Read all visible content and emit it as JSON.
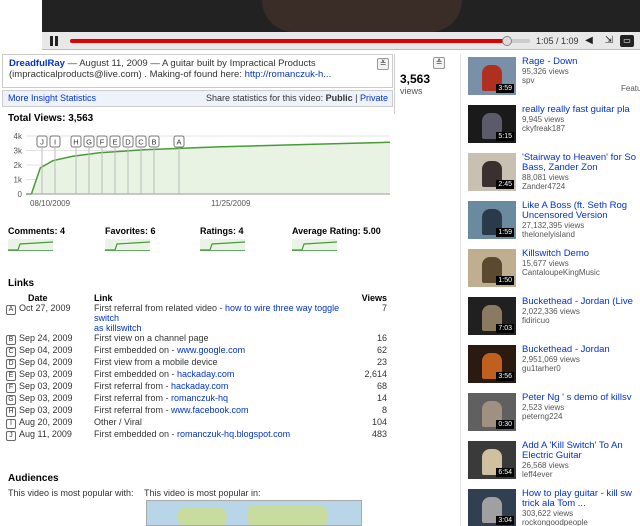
{
  "player": {
    "time": "1:05 / 1:09",
    "progress": 0.95
  },
  "description": {
    "author": "DreadfulRay",
    "line1_rest": " — August 11, 2009 — A guitar built by Impractical Products",
    "line2_text": "(impracticalproducts@live.com) . Making-of found here: ",
    "line2_link": "http://romanczuk-h..."
  },
  "views_summary": {
    "count": "3,563",
    "label": "views"
  },
  "insight": {
    "more_link": "More Insight Statistics",
    "share_prefix": "Share statistics for this video:",
    "public": "Public",
    "private": "Private"
  },
  "total_views": {
    "title": "Total Views: 3,563",
    "yticks": [
      "4k",
      "3k",
      "2k",
      "1k",
      "0"
    ],
    "xticks": [
      "08/10/2009",
      "11/25/2009"
    ],
    "marker_letters": [
      "J",
      "I",
      "H",
      "G",
      "F",
      "E",
      "D",
      "C",
      "B",
      "A"
    ]
  },
  "chart_data": {
    "type": "area",
    "title": "Total Views: 3,563",
    "x_range": [
      "2009-08-10",
      "2010-03-01"
    ],
    "ylim": [
      0,
      4000
    ],
    "points": [
      {
        "x": "2009-08-10",
        "y": 0
      },
      {
        "x": "2009-08-13",
        "y": 0
      },
      {
        "x": "2009-08-18",
        "y": 1800
      },
      {
        "x": "2009-08-25",
        "y": 2300
      },
      {
        "x": "2009-09-05",
        "y": 2600
      },
      {
        "x": "2009-09-20",
        "y": 2850
      },
      {
        "x": "2009-10-15",
        "y": 3050
      },
      {
        "x": "2009-11-25",
        "y": 3250
      },
      {
        "x": "2010-01-15",
        "y": 3420
      },
      {
        "x": "2010-03-01",
        "y": 3563
      }
    ]
  },
  "metrics": [
    {
      "label": "Comments: 4"
    },
    {
      "label": "Favorites: 6"
    },
    {
      "label": "Ratings: 4"
    },
    {
      "label": "Average Rating: 5.00"
    }
  ],
  "links_section": {
    "title": "Links",
    "headers": {
      "date": "Date",
      "link": "Link",
      "views": "Views"
    },
    "rows": [
      {
        "letter": "A",
        "date": "Oct 27, 2009",
        "text": "First referral from related video - ",
        "link": "how to wire three way toggle switch",
        "link2": "as killswitch",
        "views": "7"
      },
      {
        "letter": "B",
        "date": "Sep 24, 2009",
        "text": "First view on a channel page",
        "link": "",
        "views": "16"
      },
      {
        "letter": "C",
        "date": "Sep 04, 2009",
        "text": "First embedded on - ",
        "link": "www.google.com",
        "views": "62"
      },
      {
        "letter": "D",
        "date": "Sep 04, 2009",
        "text": "First view from a mobile device",
        "link": "",
        "views": "23"
      },
      {
        "letter": "E",
        "date": "Sep 03, 2009",
        "text": "First embedded on - ",
        "link": "hackaday.com",
        "views": "2,614"
      },
      {
        "letter": "F",
        "date": "Sep 03, 2009",
        "text": "First referral from - ",
        "link": "hackaday.com",
        "views": "68"
      },
      {
        "letter": "G",
        "date": "Sep 03, 2009",
        "text": "First referral from - ",
        "link": "romanczuk-hq",
        "views": "14"
      },
      {
        "letter": "H",
        "date": "Sep 03, 2009",
        "text": "First referral from - ",
        "link": "www.facebook.com",
        "views": "8"
      },
      {
        "letter": "I",
        "date": "Aug 20, 2009",
        "text": "Other / Viral",
        "link": "",
        "views": "104"
      },
      {
        "letter": "J",
        "date": "Aug 11, 2009",
        "text": "First embedded on - ",
        "link": "romanczuk-hq.blogspot.com",
        "views": "483"
      }
    ]
  },
  "audiences": {
    "title": "Audiences",
    "left_text": "This video is most popular with:",
    "right_text": "This video is most popular in:"
  },
  "sidebar": {
    "featured_label": "Featu",
    "items": [
      {
        "title": "Rage - Down",
        "line2": "",
        "views": "95,326 views",
        "user": "spv",
        "duration": "3:59",
        "colors": [
          "#7a8fa8",
          "#b03020"
        ]
      },
      {
        "title": "really really fast guitar pla",
        "line2": "",
        "views": "9,945 views",
        "user": "ckyfreak187",
        "duration": "5:15",
        "colors": [
          "#1a1a1a",
          "#5a5a6a"
        ]
      },
      {
        "title": "'Stairway to Heaven' for So",
        "line2": "Bass, Zander Zon",
        "views": "88,081 views",
        "user": "Zander4724",
        "duration": "2:45",
        "colors": [
          "#c8c0b0",
          "#3a3030"
        ]
      },
      {
        "title": "Like A Boss (ft. Seth Rog",
        "line2": "Uncensored Version",
        "views": "27,132,395 views",
        "user": "thelonelyisland",
        "duration": "1:59",
        "colors": [
          "#6a8aa0",
          "#2a3a4a"
        ]
      },
      {
        "title": "Killswitch Demo",
        "line2": "",
        "views": "15,677 views",
        "user": "CantaloupeKingMusic",
        "duration": "1:50",
        "colors": [
          "#bfae90",
          "#5a4a30"
        ]
      },
      {
        "title": "Buckethead - Jordan (Live",
        "line2": "",
        "views": "2,022,336 views",
        "user": "fidiricuo",
        "duration": "7:03",
        "colors": [
          "#202020",
          "#8a7a60"
        ]
      },
      {
        "title": "Buckethead - Jordan",
        "line2": "",
        "views": "2,951,069 views",
        "user": "gu1tarher0",
        "duration": "3:56",
        "colors": [
          "#2a1a10",
          "#c06020"
        ]
      },
      {
        "title": "Peter Ng ' s demo of killsv",
        "line2": "",
        "views": "2,523 views",
        "user": "peterng224",
        "duration": "0:30",
        "colors": [
          "#606060",
          "#a09080"
        ]
      },
      {
        "title": "Add A 'Kill Switch' To An",
        "line2": "Electric Guitar",
        "views": "26,568 views",
        "user": "leff4ever",
        "duration": "6:54",
        "colors": [
          "#3a3a3a",
          "#d0c0a0"
        ]
      },
      {
        "title": "How to play guitar - kill sw",
        "line2": "trick ala Tom ...",
        "views": "303,622 views",
        "user": "rockongoodpeople",
        "duration": "3:04",
        "colors": [
          "#304050",
          "#a0a0a0"
        ]
      }
    ]
  }
}
